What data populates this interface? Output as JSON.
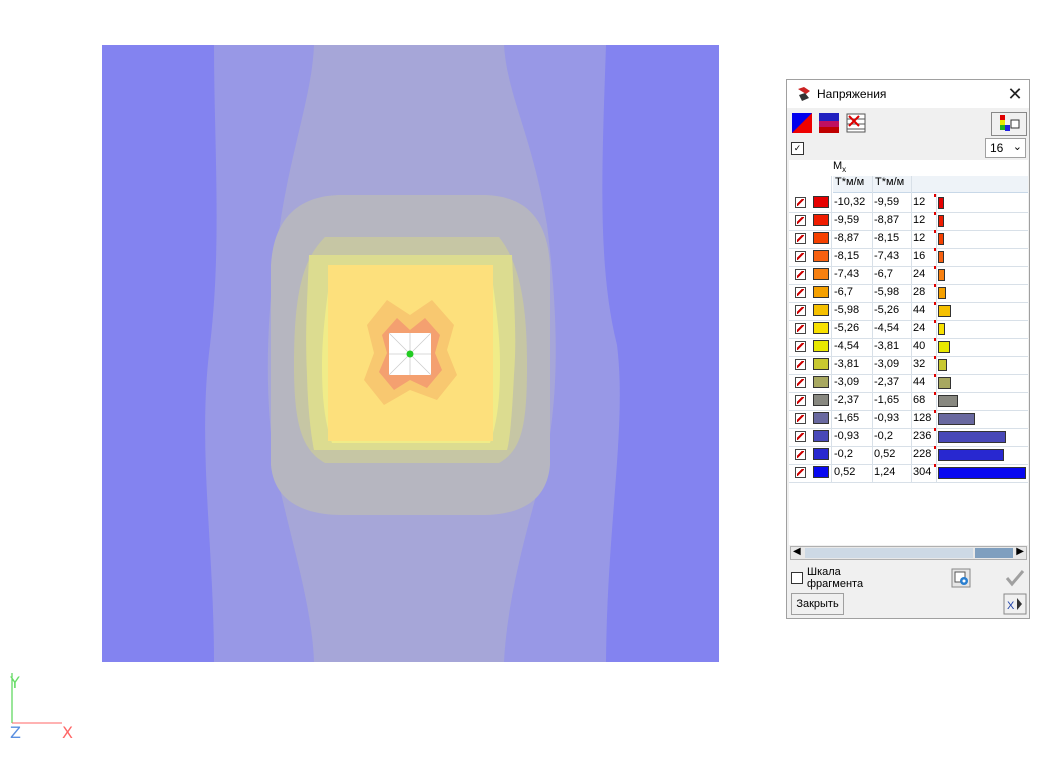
{
  "panel": {
    "title": "Напряжения",
    "close_glyph": "✕",
    "count_value": "16",
    "column_title": "Mx",
    "column_title_main": "M",
    "column_title_sub": "x",
    "unit1": "Т*м/м",
    "unit2": "Т*м/м",
    "rows": [
      {
        "from": "-10,32",
        "to": "-9,59",
        "count": "12",
        "color": "#e60000",
        "bar": 12
      },
      {
        "from": "-9,59",
        "to": "-8,87",
        "count": "12",
        "color": "#f01c00",
        "bar": 12
      },
      {
        "from": "-8,87",
        "to": "-8,15",
        "count": "12",
        "color": "#f54000",
        "bar": 12
      },
      {
        "from": "-8,15",
        "to": "-7,43",
        "count": "16",
        "color": "#f76010",
        "bar": 16
      },
      {
        "from": "-7,43",
        "to": "-6,7",
        "count": "24",
        "color": "#f88010",
        "bar": 24
      },
      {
        "from": "-6,7",
        "to": "-5,98",
        "count": "28",
        "color": "#f5a000",
        "bar": 28
      },
      {
        "from": "-5,98",
        "to": "-5,26",
        "count": "44",
        "color": "#f5c000",
        "bar": 44
      },
      {
        "from": "-5,26",
        "to": "-4,54",
        "count": "24",
        "color": "#f8e000",
        "bar": 24
      },
      {
        "from": "-4,54",
        "to": "-3,81",
        "count": "40",
        "color": "#e8e800",
        "bar": 40
      },
      {
        "from": "-3,81",
        "to": "-3,09",
        "count": "32",
        "color": "#c8c830",
        "bar": 32
      },
      {
        "from": "-3,09",
        "to": "-2,37",
        "count": "44",
        "color": "#a8a860",
        "bar": 44
      },
      {
        "from": "-2,37",
        "to": "-1,65",
        "count": "68",
        "color": "#888880",
        "bar": 68
      },
      {
        "from": "-1,65",
        "to": "-0,93",
        "count": "128",
        "color": "#6868a0",
        "bar": 128
      },
      {
        "from": "-0,93",
        "to": "-0,2",
        "count": "236",
        "color": "#4848b8",
        "bar": 236
      },
      {
        "from": "-0,2",
        "to": "0,52",
        "count": "228",
        "color": "#2828d0",
        "bar": 228
      },
      {
        "from": "0,52",
        "to": "1,24",
        "count": "304",
        "color": "#0808f0",
        "bar": 304
      }
    ],
    "scale_label_line1": "Шкала",
    "scale_label_line2": "фрагмента",
    "close_button": "Закрыть",
    "icons": {
      "title": "stress-icon",
      "tool1": "color-fill-icon",
      "tool2": "gradient-icon",
      "tool3": "table-delete-icon",
      "tool4": "palette-icon",
      "gear": "settings-icon",
      "ok": "checkmark-icon",
      "help": "help-icon"
    }
  },
  "axes": {
    "y": "Y",
    "z": "Z",
    "x": "X"
  },
  "colors": {
    "outer": "#8383f0",
    "band2": "#a6a6dc",
    "band3": "#b4b4c8",
    "band4": "#c4c4a8",
    "band5": "#d8d890",
    "band6": "#f0ec88",
    "inner": "#fde07c",
    "accent": "#2a7fd0"
  }
}
